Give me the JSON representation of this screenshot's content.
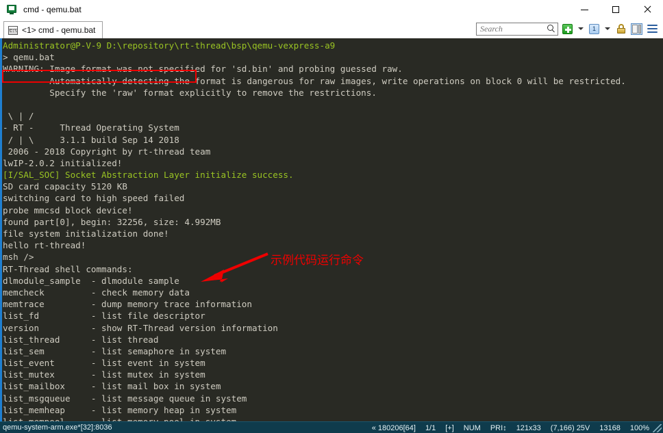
{
  "window": {
    "title": "cmd - qemu.bat",
    "icon": "console-app-icon",
    "minimize_label": "Minimize",
    "maximize_label": "Maximize",
    "close_label": "Close"
  },
  "tabs": [
    {
      "label": "<1> cmd - qemu.bat",
      "icon": "cmd-window-icon",
      "active": true
    }
  ],
  "toolbar": {
    "search": {
      "placeholder": "Search",
      "value": ""
    },
    "new_tab_label": "+",
    "session_number": "1",
    "icons": [
      "plus-icon",
      "chevron-down-icon",
      "session-number-icon",
      "chevron-down-icon",
      "lock-icon",
      "split-pane-icon",
      "hamburger-menu-icon"
    ]
  },
  "terminal": {
    "lines": [
      {
        "text": "Administrator@P-V-9 D:\\repository\\rt-thread\\bsp\\qemu-vexpress-a9",
        "color": "green"
      },
      {
        "text": "> qemu.bat",
        "color": "grey"
      },
      {
        "text": "WARNING: Image format was not specified for 'sd.bin' and probing guessed raw.",
        "color": "grey"
      },
      {
        "text": "         Automatically detecting the format is dangerous for raw images, write operations on block 0 will be restricted.",
        "color": "grey"
      },
      {
        "text": "         Specify the 'raw' format explicitly to remove the restrictions.",
        "color": "grey"
      },
      {
        "text": "",
        "color": "grey"
      },
      {
        "text": " \\ | /",
        "color": "grey"
      },
      {
        "text": "- RT -     Thread Operating System",
        "color": "grey"
      },
      {
        "text": " / | \\     3.1.1 build Sep 14 2018",
        "color": "grey"
      },
      {
        "text": " 2006 - 2018 Copyright by rt-thread team",
        "color": "grey"
      },
      {
        "text": "lwIP-2.0.2 initialized!",
        "color": "grey"
      },
      {
        "text": "[I/SAL_SOC] Socket Abstraction Layer initialize success.",
        "color": "green"
      },
      {
        "text": "SD card capacity 5120 KB",
        "color": "grey"
      },
      {
        "text": "switching card to high speed failed",
        "color": "grey"
      },
      {
        "text": "probe mmcsd block device!",
        "color": "grey"
      },
      {
        "text": "found part[0], begin: 32256, size: 4.992MB",
        "color": "grey"
      },
      {
        "text": "file system initialization done!",
        "color": "grey"
      },
      {
        "text": "hello rt-thread!",
        "color": "grey"
      },
      {
        "text": "msh />",
        "color": "grey"
      },
      {
        "text": "RT-Thread shell commands:",
        "color": "grey"
      },
      {
        "text": "dlmodule_sample  - dlmodule sample",
        "color": "grey"
      },
      {
        "text": "memcheck         - check memory data",
        "color": "grey"
      },
      {
        "text": "memtrace         - dump memory trace information",
        "color": "grey"
      },
      {
        "text": "list_fd          - list file descriptor",
        "color": "grey"
      },
      {
        "text": "version          - show RT-Thread version information",
        "color": "grey"
      },
      {
        "text": "list_thread      - list thread",
        "color": "grey"
      },
      {
        "text": "list_sem         - list semaphore in system",
        "color": "grey"
      },
      {
        "text": "list_event       - list event in system",
        "color": "grey"
      },
      {
        "text": "list_mutex       - list mutex in system",
        "color": "grey"
      },
      {
        "text": "list_mailbox     - list mail box in system",
        "color": "grey"
      },
      {
        "text": "list_msgqueue    - list message queue in system",
        "color": "grey"
      },
      {
        "text": "list_memheap     - list memory heap in system",
        "color": "grey"
      },
      {
        "text": "list_mempool     - list memory pool in system",
        "color": "grey"
      }
    ]
  },
  "annotation": {
    "text": "示例代码运行命令",
    "color": "#ee0000",
    "highlight_target": "dlmodule_sample  - dlmodule sample"
  },
  "statusbar": {
    "process": "qemu-system-arm.exe*[32]:8036",
    "build": "« 180206[64]",
    "pages": "1/1",
    "plus": "[+]",
    "num_lock": "NUM",
    "priority": "PRI↕",
    "size": "121x33",
    "cursor": "(7,166) 25V",
    "lines": "13168",
    "zoom": "100%"
  }
}
